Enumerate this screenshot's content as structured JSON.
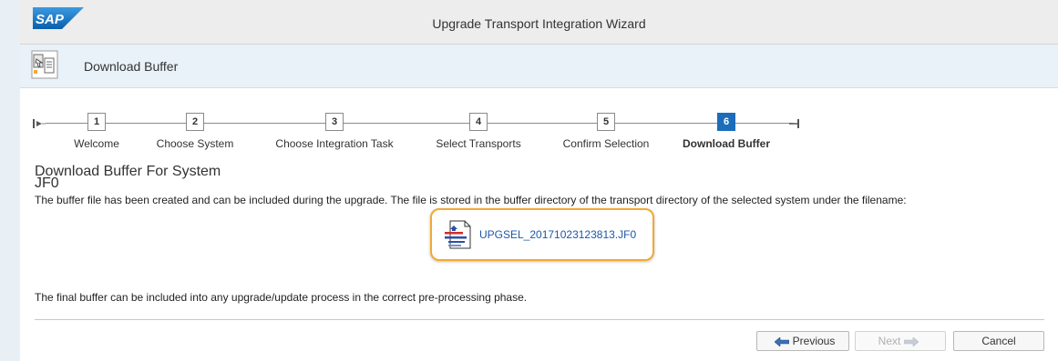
{
  "window": {
    "title": "Upgrade Transport Integration Wizard",
    "logo_text": "SAP"
  },
  "header": {
    "title": "Download Buffer"
  },
  "steps": [
    {
      "number": "1",
      "label": "Welcome"
    },
    {
      "number": "2",
      "label": "Choose System"
    },
    {
      "number": "3",
      "label": "Choose Integration Task"
    },
    {
      "number": "4",
      "label": "Select Transports"
    },
    {
      "number": "5",
      "label": "Confirm Selection"
    },
    {
      "number": "6",
      "label": "Download Buffer",
      "active": true
    }
  ],
  "content": {
    "section_title": "Download Buffer For System",
    "system_id": "JF0",
    "description": "The buffer file has been created and can be included during the upgrade. The file is stored in the buffer directory of the transport directory of the selected system under the filename:",
    "file_name": "UPGSEL_20171023123813.JF0",
    "final_text": "The final buffer can be included into any upgrade/update process in the correct pre-processing phase."
  },
  "footer": {
    "previous_label": "Previous",
    "next_label": "Next",
    "cancel_label": "Cancel"
  },
  "colors": {
    "accent": "#1b6dbb",
    "highlight": "#f2a934",
    "link": "#1d57a8"
  }
}
